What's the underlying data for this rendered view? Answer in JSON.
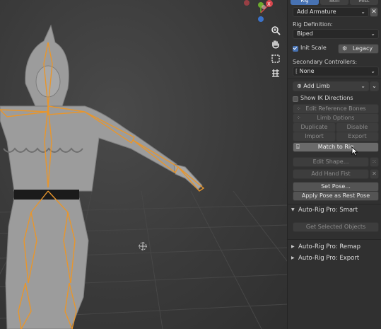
{
  "panel": {
    "tabs": [
      "Rig",
      "Skin",
      "Misc"
    ],
    "add_armature": "Add Armature",
    "rig_definition_label": "Rig Definition:",
    "rig_definition_value": "Biped",
    "init_scale_label": "Init Scale",
    "legacy_label": "Legacy",
    "secondary_label": "Secondary Controllers:",
    "secondary_value": "None",
    "add_limb_label": "Add Limb",
    "show_ik_label": "Show IK Directions",
    "edit_reference_bones": "Edit Reference Bones",
    "limb_options": "Limb Options",
    "duplicate": "Duplicate",
    "disable": "Disable",
    "import": "Import",
    "export": "Export",
    "match_to_rig": "Match to Rig",
    "edit_shape": "Edit Shape...",
    "add_hand_fist": "Add Hand Fist",
    "set_pose": "Set Pose...",
    "apply_pose_rest": "Apply Pose as Rest Pose",
    "section_smart": "Auto-Rig Pro: Smart",
    "get_selected_objects": "Get Selected Objects",
    "section_remap": "Auto-Rig Pro: Remap",
    "section_export": "Auto-Rig Pro: Export"
  },
  "icons": {
    "viewport": [
      "zoom-icon",
      "hand-pan-icon",
      "camera-icon",
      "grid-ortho-icon"
    ],
    "colors": {
      "accent": "#4772b3",
      "bone_orange": "#e8962c",
      "gizmo_red": "#d7454c",
      "gizmo_green": "#6cab2e",
      "gizmo_blue": "#3b72c9"
    }
  }
}
